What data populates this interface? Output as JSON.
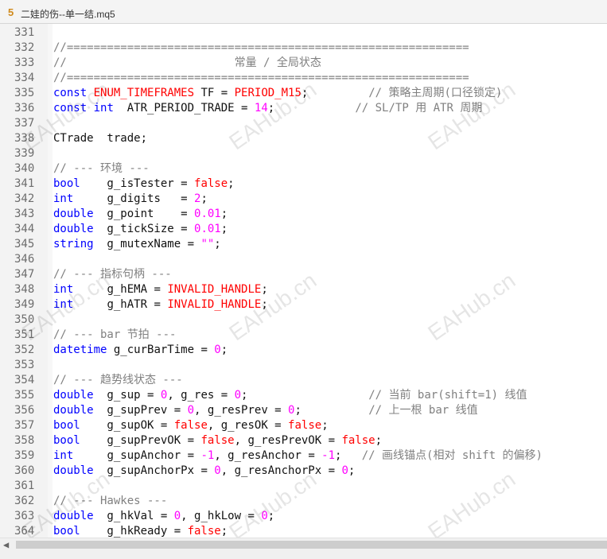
{
  "window": {
    "tab_number": "5",
    "filename": "二娃的伤--单一结.mq5"
  },
  "watermark": "EAHub.cn",
  "code_lines": [
    {
      "n": "331",
      "t": []
    },
    {
      "n": "332",
      "t": [
        {
          "c": "cm",
          "s": "//============================================================"
        }
      ]
    },
    {
      "n": "333",
      "t": [
        {
          "c": "cm",
          "s": "//                         常量 / 全局状态"
        }
      ]
    },
    {
      "n": "334",
      "t": [
        {
          "c": "cm",
          "s": "//============================================================"
        }
      ]
    },
    {
      "n": "335",
      "t": [
        {
          "c": "kw",
          "s": "const"
        },
        {
          "c": "",
          "s": " "
        },
        {
          "c": "rd",
          "s": "ENUM_TIMEFRAMES"
        },
        {
          "c": "",
          "s": " TF = "
        },
        {
          "c": "rd",
          "s": "PERIOD_M15"
        },
        {
          "c": "",
          "s": ";         "
        },
        {
          "c": "cm",
          "s": "// 策略主周期(口径锁定)"
        }
      ]
    },
    {
      "n": "336",
      "t": [
        {
          "c": "kw",
          "s": "const"
        },
        {
          "c": "",
          "s": " "
        },
        {
          "c": "kw",
          "s": "int"
        },
        {
          "c": "",
          "s": "  ATR_PERIOD_TRADE = "
        },
        {
          "c": "pk",
          "s": "14"
        },
        {
          "c": "",
          "s": ";            "
        },
        {
          "c": "cm",
          "s": "// SL/TP 用 ATR 周期"
        }
      ]
    },
    {
      "n": "337",
      "t": []
    },
    {
      "n": "338",
      "t": [
        {
          "c": "",
          "s": "CTrade  trade;"
        }
      ]
    },
    {
      "n": "339",
      "t": []
    },
    {
      "n": "340",
      "t": [
        {
          "c": "cm",
          "s": "// --- 环境 ---"
        }
      ]
    },
    {
      "n": "341",
      "t": [
        {
          "c": "kw",
          "s": "bool"
        },
        {
          "c": "",
          "s": "    g_isTester = "
        },
        {
          "c": "rd",
          "s": "false"
        },
        {
          "c": "",
          "s": ";"
        }
      ]
    },
    {
      "n": "342",
      "t": [
        {
          "c": "kw",
          "s": "int"
        },
        {
          "c": "",
          "s": "     g_digits   = "
        },
        {
          "c": "pk",
          "s": "2"
        },
        {
          "c": "",
          "s": ";"
        }
      ]
    },
    {
      "n": "343",
      "t": [
        {
          "c": "kw",
          "s": "double"
        },
        {
          "c": "",
          "s": "  g_point    = "
        },
        {
          "c": "pk",
          "s": "0.01"
        },
        {
          "c": "",
          "s": ";"
        }
      ]
    },
    {
      "n": "344",
      "t": [
        {
          "c": "kw",
          "s": "double"
        },
        {
          "c": "",
          "s": "  g_tickSize = "
        },
        {
          "c": "pk",
          "s": "0.01"
        },
        {
          "c": "",
          "s": ";"
        }
      ]
    },
    {
      "n": "345",
      "t": [
        {
          "c": "kw",
          "s": "string"
        },
        {
          "c": "",
          "s": "  g_mutexName = "
        },
        {
          "c": "pk",
          "s": "\"\""
        },
        {
          "c": "",
          "s": ";"
        }
      ]
    },
    {
      "n": "346",
      "t": []
    },
    {
      "n": "347",
      "t": [
        {
          "c": "cm",
          "s": "// --- 指标句柄 ---"
        }
      ]
    },
    {
      "n": "348",
      "t": [
        {
          "c": "kw",
          "s": "int"
        },
        {
          "c": "",
          "s": "     g_hEMA = "
        },
        {
          "c": "rd",
          "s": "INVALID_HANDLE"
        },
        {
          "c": "",
          "s": ";"
        }
      ]
    },
    {
      "n": "349",
      "t": [
        {
          "c": "kw",
          "s": "int"
        },
        {
          "c": "",
          "s": "     g_hATR = "
        },
        {
          "c": "rd",
          "s": "INVALID_HANDLE"
        },
        {
          "c": "",
          "s": ";"
        }
      ]
    },
    {
      "n": "350",
      "t": []
    },
    {
      "n": "351",
      "t": [
        {
          "c": "cm",
          "s": "// --- bar 节拍 ---"
        }
      ]
    },
    {
      "n": "352",
      "t": [
        {
          "c": "kw",
          "s": "datetime"
        },
        {
          "c": "",
          "s": " g_curBarTime = "
        },
        {
          "c": "pk",
          "s": "0"
        },
        {
          "c": "",
          "s": ";"
        }
      ]
    },
    {
      "n": "353",
      "t": []
    },
    {
      "n": "354",
      "t": [
        {
          "c": "cm",
          "s": "// --- 趋势线状态 ---"
        }
      ]
    },
    {
      "n": "355",
      "t": [
        {
          "c": "kw",
          "s": "double"
        },
        {
          "c": "",
          "s": "  g_sup = "
        },
        {
          "c": "pk",
          "s": "0"
        },
        {
          "c": "",
          "s": ", g_res = "
        },
        {
          "c": "pk",
          "s": "0"
        },
        {
          "c": "",
          "s": ";                  "
        },
        {
          "c": "cm",
          "s": "// 当前 bar(shift=1) 线值"
        }
      ]
    },
    {
      "n": "356",
      "t": [
        {
          "c": "kw",
          "s": "double"
        },
        {
          "c": "",
          "s": "  g_supPrev = "
        },
        {
          "c": "pk",
          "s": "0"
        },
        {
          "c": "",
          "s": ", g_resPrev = "
        },
        {
          "c": "pk",
          "s": "0"
        },
        {
          "c": "",
          "s": ";          "
        },
        {
          "c": "cm",
          "s": "// 上一根 bar 线值"
        }
      ]
    },
    {
      "n": "357",
      "t": [
        {
          "c": "kw",
          "s": "bool"
        },
        {
          "c": "",
          "s": "    g_supOK = "
        },
        {
          "c": "rd",
          "s": "false"
        },
        {
          "c": "",
          "s": ", g_resOK = "
        },
        {
          "c": "rd",
          "s": "false"
        },
        {
          "c": "",
          "s": ";"
        }
      ]
    },
    {
      "n": "358",
      "t": [
        {
          "c": "kw",
          "s": "bool"
        },
        {
          "c": "",
          "s": "    g_supPrevOK = "
        },
        {
          "c": "rd",
          "s": "false"
        },
        {
          "c": "",
          "s": ", g_resPrevOK = "
        },
        {
          "c": "rd",
          "s": "false"
        },
        {
          "c": "",
          "s": ";"
        }
      ]
    },
    {
      "n": "359",
      "t": [
        {
          "c": "kw",
          "s": "int"
        },
        {
          "c": "",
          "s": "     g_supAnchor = "
        },
        {
          "c": "pk",
          "s": "-1"
        },
        {
          "c": "",
          "s": ", g_resAnchor = "
        },
        {
          "c": "pk",
          "s": "-1"
        },
        {
          "c": "",
          "s": ";   "
        },
        {
          "c": "cm",
          "s": "// 画线锚点(相对 shift 的偏移)"
        }
      ]
    },
    {
      "n": "360",
      "t": [
        {
          "c": "kw",
          "s": "double"
        },
        {
          "c": "",
          "s": "  g_supAnchorPx = "
        },
        {
          "c": "pk",
          "s": "0"
        },
        {
          "c": "",
          "s": ", g_resAnchorPx = "
        },
        {
          "c": "pk",
          "s": "0"
        },
        {
          "c": "",
          "s": ";"
        }
      ]
    },
    {
      "n": "361",
      "t": []
    },
    {
      "n": "362",
      "t": [
        {
          "c": "cm",
          "s": "// --- Hawkes ---"
        }
      ]
    },
    {
      "n": "363",
      "t": [
        {
          "c": "kw",
          "s": "double"
        },
        {
          "c": "",
          "s": "  g_hkVal = "
        },
        {
          "c": "pk",
          "s": "0"
        },
        {
          "c": "",
          "s": ", g_hkLow = "
        },
        {
          "c": "pk",
          "s": "0"
        },
        {
          "c": "",
          "s": ";"
        }
      ]
    },
    {
      "n": "364",
      "t": [
        {
          "c": "kw",
          "s": "bool"
        },
        {
          "c": "",
          "s": "    g_hkReady = "
        },
        {
          "c": "rd",
          "s": "false"
        },
        {
          "c": "",
          "s": ";"
        }
      ]
    }
  ]
}
